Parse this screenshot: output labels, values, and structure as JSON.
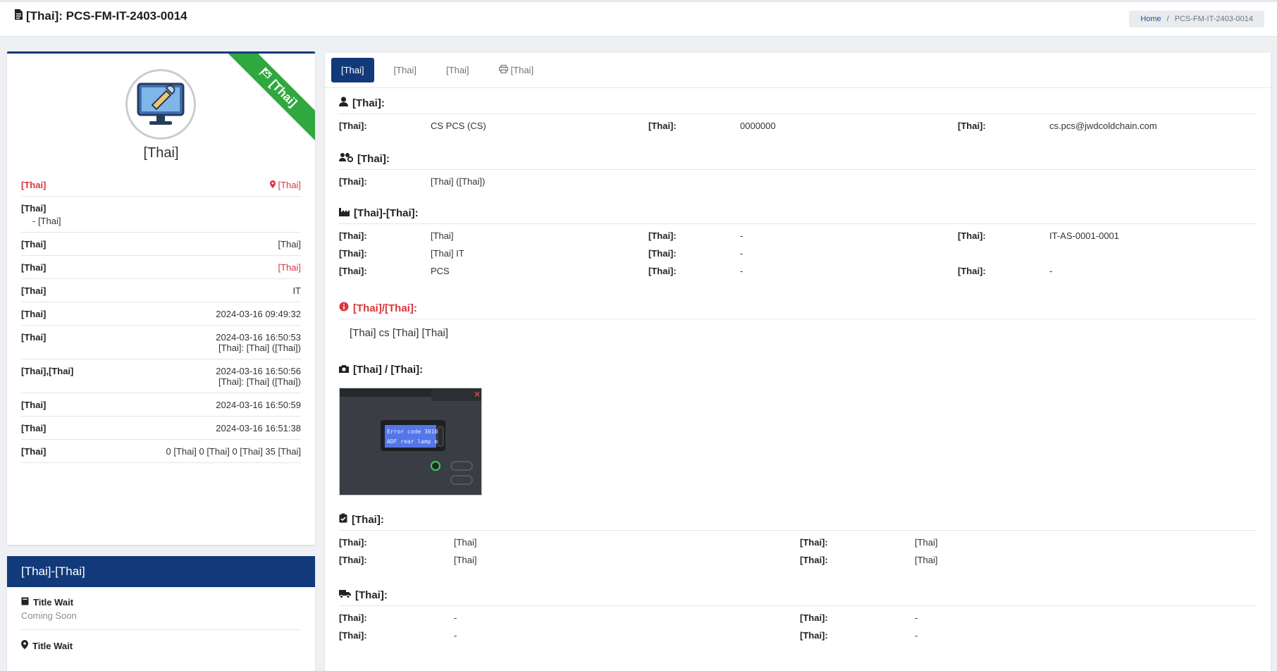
{
  "header": {
    "title": "[Thai]: PCS-FM-IT-2403-0014",
    "breadcrumb_home": "Home",
    "breadcrumb_sep": "/",
    "breadcrumb_current": "PCS-FM-IT-2403-0014"
  },
  "status_card": {
    "ribbon": "[Thai]",
    "title": "[Thai]",
    "rows": [
      {
        "label": "[Thai]",
        "value": "[Thai]"
      },
      {
        "label": "[Thai]",
        "value": "- [Thai]"
      },
      {
        "label": "[Thai]",
        "value": "[Thai]"
      },
      {
        "label": "[Thai]",
        "value": "[Thai]"
      },
      {
        "label": "[Thai]",
        "value": "IT"
      },
      {
        "label": "[Thai]",
        "value": "2024-03-16 09:49:32"
      },
      {
        "label": "[Thai]",
        "value": "2024-03-16 16:50:53",
        "by": "[Thai]: [Thai] ([Thai])"
      },
      {
        "label": "[Thai],[Thai]",
        "value": "2024-03-16 16:50:56",
        "by": "[Thai]: [Thai] ([Thai])"
      },
      {
        "label": "[Thai]",
        "value": "2024-03-16 16:50:59"
      },
      {
        "label": "[Thai]",
        "value": "2024-03-16 16:51:38"
      },
      {
        "label": "[Thai]",
        "value": "0 [Thai] 0 [Thai] 0 [Thai] 35 [Thai]"
      }
    ]
  },
  "machine_card": {
    "title": "[Thai]-[Thai]",
    "items": [
      {
        "title": "Title Wait",
        "sub": "Coming Soon"
      },
      {
        "title": "Title Wait",
        "sub": ""
      }
    ]
  },
  "tabs": [
    "[Thai]",
    "[Thai]",
    "[Thai]",
    "[Thai]"
  ],
  "reporter": {
    "heading": "[Thai]:",
    "name_label": "[Thai]:",
    "name": "CS PCS (CS)",
    "emp_label": "[Thai]:",
    "emp": "0000000",
    "email_label": "[Thai]:",
    "email": "cs.pcs@jwdcoldchain.com"
  },
  "responsible": {
    "heading": "[Thai]:",
    "label": "[Thai]:",
    "value": "[Thai] ([Thai])"
  },
  "machine": {
    "heading": "[Thai]-[Thai]:",
    "type_label": "[Thai]:",
    "type": "[Thai]",
    "serial_label": "[Thai]:",
    "serial": "-",
    "code_label": "[Thai]:",
    "code": "IT-AS-0001-0001",
    "name_label": "[Thai]:",
    "name": "[Thai] IT",
    "model_label": "[Thai]:",
    "model": "-",
    "site_label": "[Thai]:",
    "site": "PCS",
    "building_label": "[Thai]:",
    "building": "-",
    "place_label": "[Thai]:",
    "place": "-"
  },
  "problem": {
    "heading": "[Thai]/[Thai]:",
    "text": "[Thai] cs [Thai] [Thai]"
  },
  "photo": {
    "heading": "[Thai] / [Thai]:",
    "screen_line1": "Error code 3010",
    "screen_line2": "ADF rear lamp er"
  },
  "summary": {
    "heading": "[Thai]:",
    "code_label": "[Thai]:",
    "code": "[Thai]",
    "repair_label": "[Thai]:",
    "repair": "[Thai]",
    "cause_label": "[Thai]:",
    "cause": "[Thai]",
    "fix_label": "[Thai]:",
    "fix": "[Thai]"
  },
  "outsource": {
    "heading": "[Thai]:",
    "reason_label": "[Thai]:",
    "reason": "-",
    "send_label": "[Thai]:",
    "send": "-",
    "supplier_label": "[Thai]:",
    "supplier": "-",
    "return_label": "[Thai]:",
    "return": "-"
  },
  "colors": {
    "primary": "#123a7a",
    "ribbon": "#2fa83f",
    "danger": "#d9363e"
  }
}
